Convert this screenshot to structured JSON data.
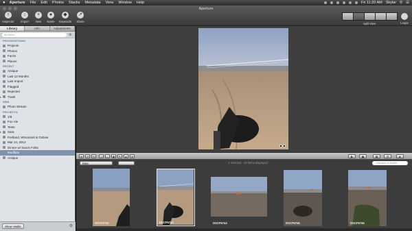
{
  "menubar": {
    "apple": "",
    "items": [
      "Aperture",
      "File",
      "Edit",
      "Photos",
      "Stacks",
      "Metadata",
      "View",
      "Window",
      "Help"
    ],
    "clock": "Fri 11:20 AM",
    "user": "Skylar"
  },
  "window": {
    "title": "Aperture"
  },
  "toolbar": {
    "buttons": [
      {
        "label": "Inspector",
        "icon": "i"
      },
      {
        "label": "Import",
        "icon": "↓"
      },
      {
        "label": "New",
        "icon": "+"
      },
      {
        "label": "Name",
        "icon": "●"
      },
      {
        "label": "Keywords",
        "icon": "◆"
      },
      {
        "label": "Share",
        "icon": "↗"
      }
    ],
    "split_view_label": "Split View",
    "loupe_label": "Loupe"
  },
  "sidebar": {
    "tabs": [
      "Library",
      "Info",
      "Adjustments"
    ],
    "active_tab": "Library",
    "search_placeholder": "All Items",
    "sections": [
      {
        "title": "PROVINCETOWN",
        "items": [
          {
            "label": "Projects"
          },
          {
            "label": "Photos"
          },
          {
            "label": "Faces"
          },
          {
            "label": "Places"
          }
        ]
      },
      {
        "title": "RECENT",
        "items": [
          {
            "label": "Antique"
          },
          {
            "label": "Last 12 Months"
          },
          {
            "label": "Last Import"
          },
          {
            "label": "Flagged"
          },
          {
            "label": "Rejected"
          },
          {
            "label": "Trash"
          }
        ]
      },
      {
        "title": "WEB",
        "items": [
          {
            "label": "Photo Stream"
          }
        ]
      },
      {
        "title": "PROJECTS",
        "items": [
          {
            "label": "1/8"
          },
          {
            "label": "Fox Vie"
          },
          {
            "label": "Tests"
          },
          {
            "label": "Sara"
          },
          {
            "label": "Portland, Wiscasset & Oxbow"
          },
          {
            "label": "Mar 24, 2013"
          },
          {
            "label": "Dinner w/ Sara's Folks"
          },
          {
            "label": "Mudflats"
          },
          {
            "label": "Antique"
          }
        ]
      }
    ],
    "show_vaults_label": "Show Vaults"
  },
  "browser": {
    "sort_label": "Date",
    "status": "1 selected - 42 items displayed",
    "filter_placeholder": "Unrated or Better",
    "thumbnails": [
      {
        "caption": "DSCF5742",
        "selected": false
      },
      {
        "caption": "DSCF5743",
        "selected": true
      },
      {
        "caption": "DSCF5744",
        "selected": false
      },
      {
        "caption": "DSCF5745",
        "selected": false
      },
      {
        "caption": "DSCF5746",
        "selected": false
      }
    ]
  }
}
